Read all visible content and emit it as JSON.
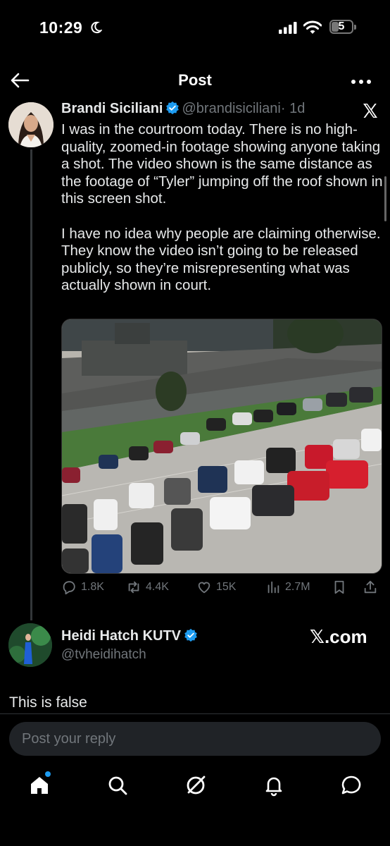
{
  "status_bar": {
    "time": "10:29",
    "battery": "5"
  },
  "header": {
    "title": "Post"
  },
  "tweet": {
    "author_name": "Brandi Siciliani",
    "handle": "@brandisiciliani",
    "time": "· 1d",
    "text": "I was in the courtroom today. There is no high-quality, zoomed-in footage showing anyone taking a shot. The video shown is the same distance as the footage of “Tyler” jumping off the roof shown in this screen shot.\n\nI have no idea why people are claiming otherwise. They know the video isn’t going to be released publicly, so they’re misrepresenting what was actually shown in court.",
    "stats": {
      "replies": "1.8K",
      "reposts": "4.4K",
      "likes": "15K",
      "views": "2.7M"
    }
  },
  "reply": {
    "author_name": "Heidi Hatch KUTV",
    "handle": "@tvheidihatch",
    "text": "This is false",
    "watermark": "𝕏.com"
  },
  "composer": {
    "placeholder": "Post your reply"
  },
  "colors": {
    "accent": "#1d9bf0",
    "muted": "#71767b",
    "background": "#000000"
  },
  "icons": [
    "back-arrow-icon",
    "more-icon",
    "verified-icon",
    "x-logo-icon",
    "reply-icon",
    "repost-icon",
    "like-icon",
    "views-icon",
    "bookmark-icon",
    "share-icon",
    "home-icon",
    "search-icon",
    "grok-icon",
    "notifications-icon",
    "messages-icon"
  ]
}
